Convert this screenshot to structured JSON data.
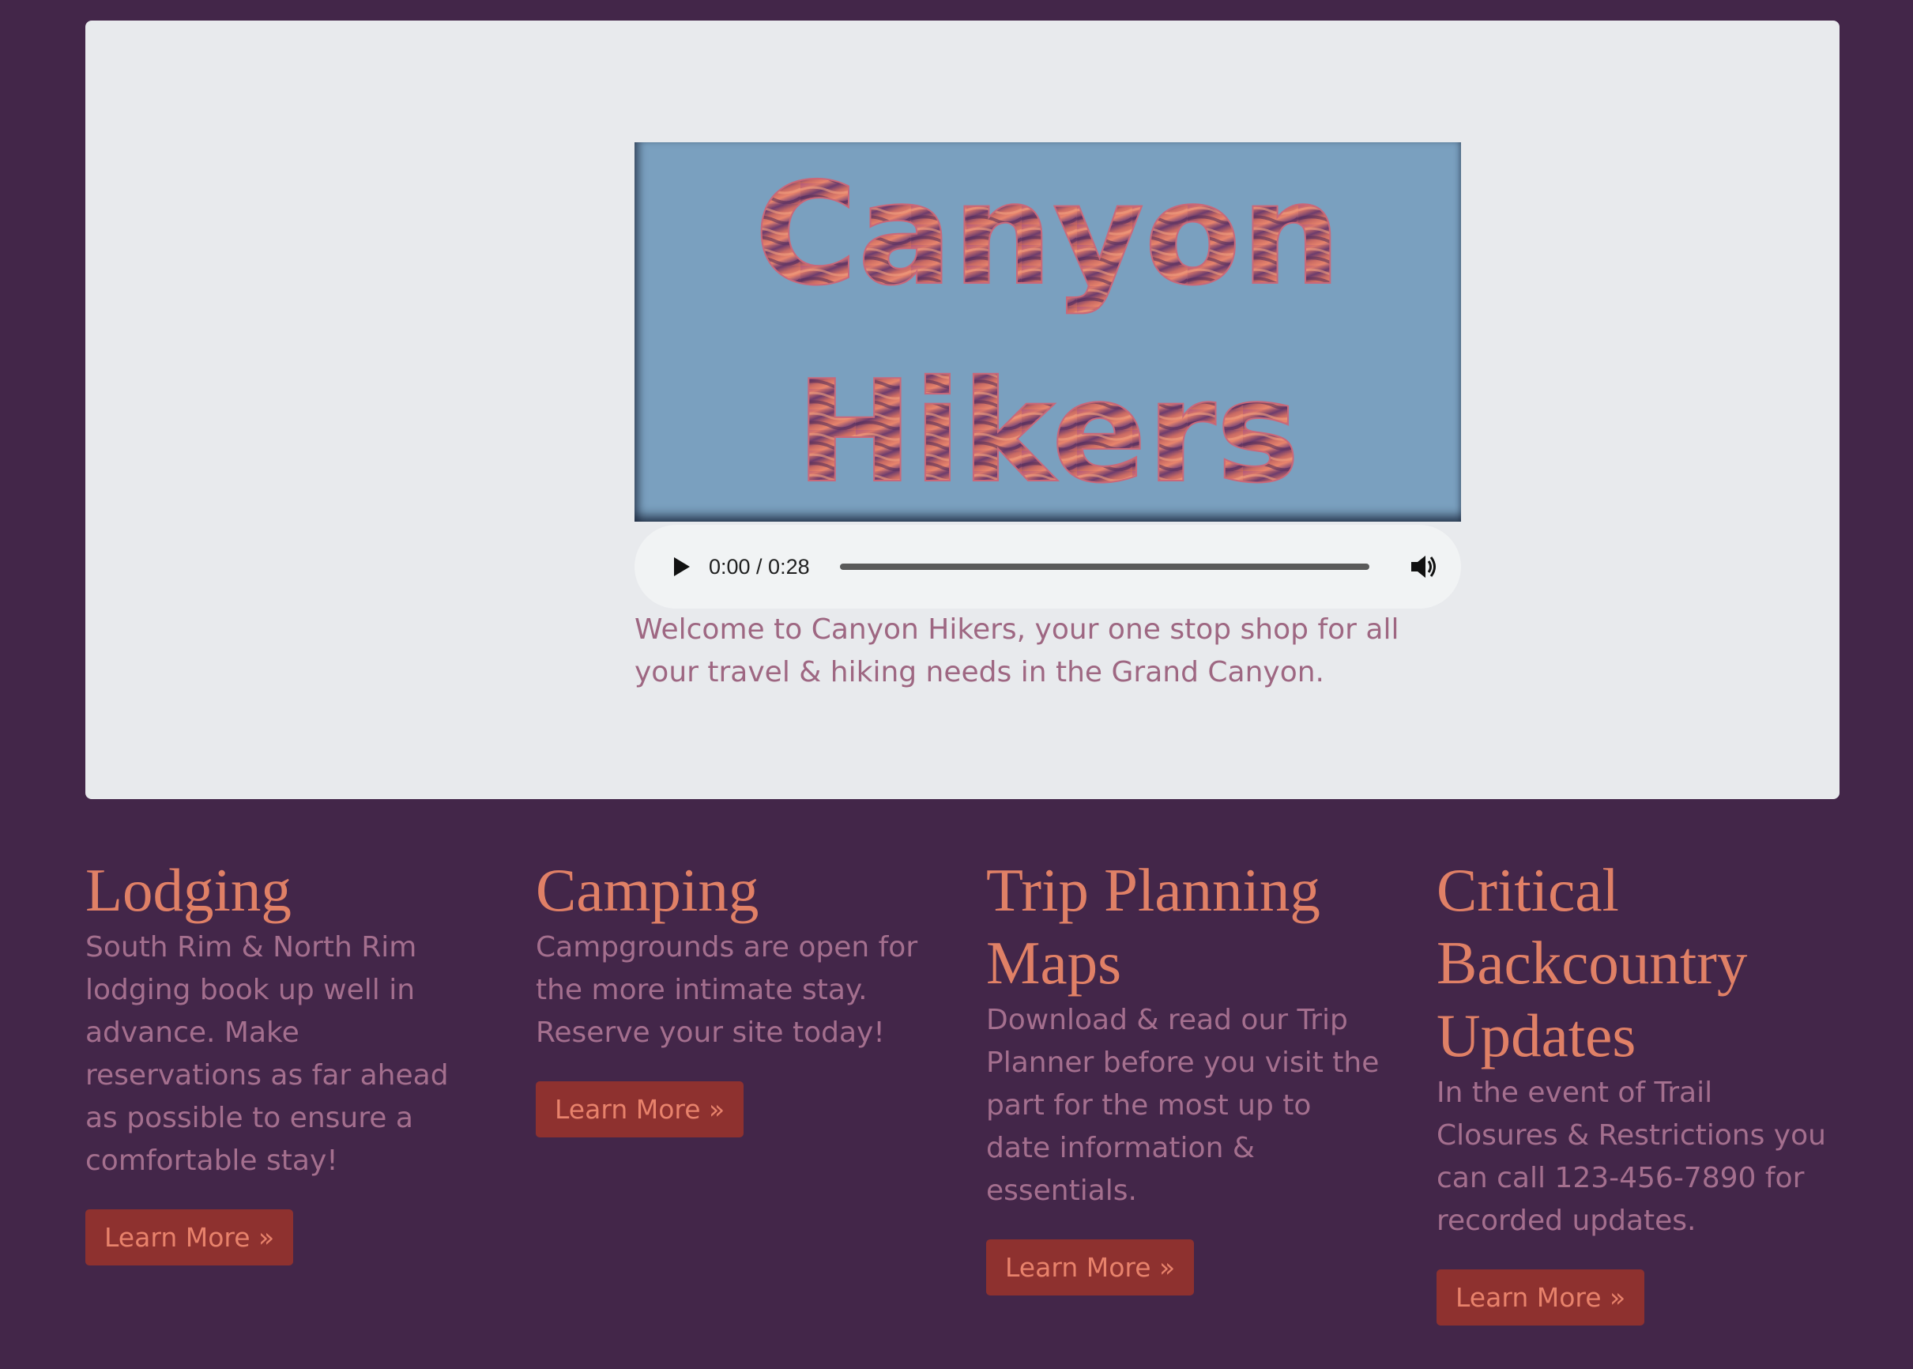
{
  "hero": {
    "logo": {
      "line1": "Canyon",
      "line2": "Hikers",
      "background": "#7aa0bf"
    },
    "audio": {
      "time": "0:00 / 0:28",
      "play_icon": "play-icon",
      "volume_icon": "volume-icon"
    },
    "welcome_text": "Welcome to Canyon Hikers, your one stop shop for all your travel & hiking needs in the Grand Canyon."
  },
  "features": [
    {
      "title": "Lodging",
      "text": "South Rim & North Rim lodging book up well in advance. Make reservations as far ahead as possible to ensure a comfortable stay!",
      "button": "Learn More »"
    },
    {
      "title": "Camping",
      "text": "Campgrounds are open for the more intimate stay. Reserve your site today!",
      "button": "Learn More »"
    },
    {
      "title": "Trip Planning Maps",
      "text": "Download & read our Trip Planner before you visit the part for the most up to date information & essentials.",
      "button": "Learn More »"
    },
    {
      "title": "Critical Backcountry Updates",
      "text": "In the event of Trail Closures & Restrictions you can call 123-456-7890 for recorded updates.",
      "button": "Learn More »"
    }
  ],
  "colors": {
    "page_background": "#432649",
    "hero_background": "#e8eaed",
    "heading": "#e08066",
    "body_text": "#a46f8e",
    "button_background": "#8e312f",
    "button_text": "#e8826b"
  }
}
